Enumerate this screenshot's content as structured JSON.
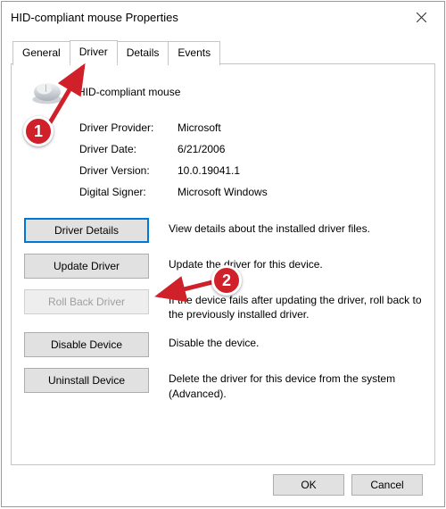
{
  "window": {
    "title": "HID-compliant mouse Properties"
  },
  "tabs": {
    "general": "General",
    "driver": "Driver",
    "details": "Details",
    "events": "Events"
  },
  "device": {
    "name": "HID-compliant mouse"
  },
  "info": {
    "provider_label": "Driver Provider:",
    "provider_value": "Microsoft",
    "date_label": "Driver Date:",
    "date_value": "6/21/2006",
    "version_label": "Driver Version:",
    "version_value": "10.0.19041.1",
    "signer_label": "Digital Signer:",
    "signer_value": "Microsoft Windows"
  },
  "buttons": {
    "details": "Driver Details",
    "details_desc": "View details about the installed driver files.",
    "update": "Update Driver",
    "update_desc": "Update the driver for this device.",
    "rollback": "Roll Back Driver",
    "rollback_desc": "If the device fails after updating the driver, roll back to the previously installed driver.",
    "disable": "Disable Device",
    "disable_desc": "Disable the device.",
    "uninstall": "Uninstall Device",
    "uninstall_desc": "Delete the driver for this device from the system (Advanced)."
  },
  "footer": {
    "ok": "OK",
    "cancel": "Cancel"
  },
  "annotations": {
    "badge1": "1",
    "badge2": "2",
    "colors": {
      "badge_bg": "#d0202a",
      "arrow": "#d0202a"
    }
  }
}
